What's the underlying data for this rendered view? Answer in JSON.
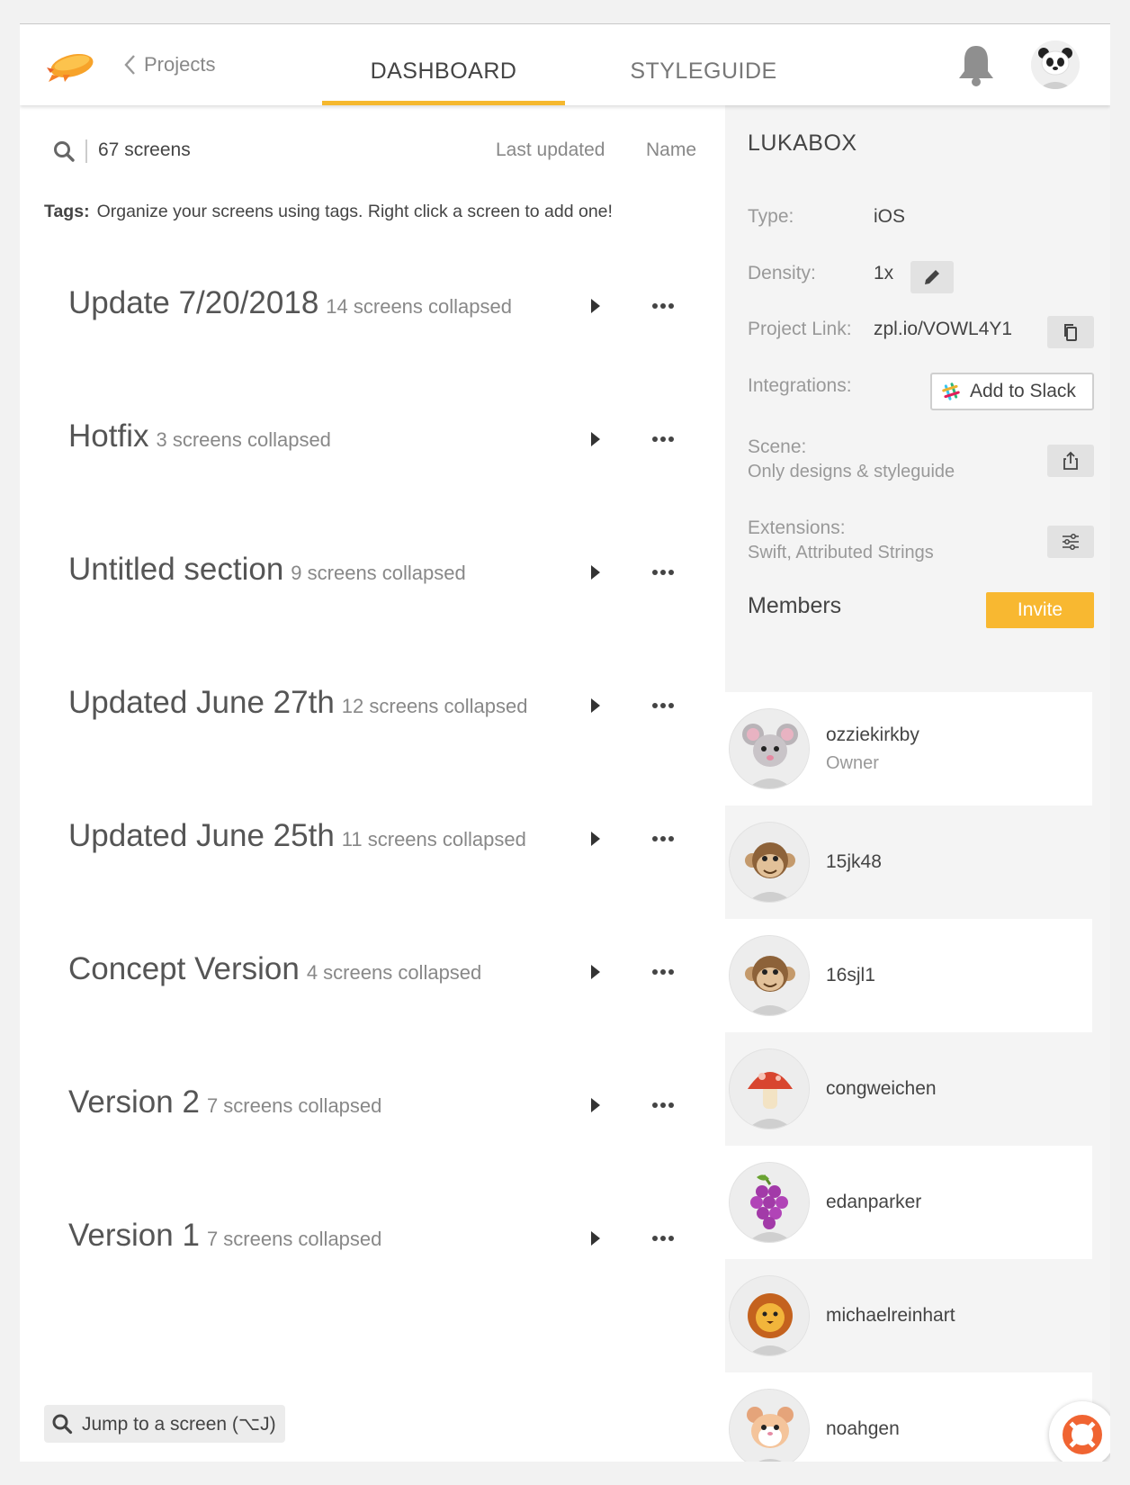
{
  "header": {
    "back_label": "Projects",
    "tabs": [
      {
        "label": "DASHBOARD",
        "active": true
      },
      {
        "label": "STYLEGUIDE",
        "active": false
      }
    ],
    "accent_color": "#f5b82e"
  },
  "dashboard": {
    "screen_count": "67 screens",
    "sort_options": [
      "Last updated",
      "Name"
    ],
    "tags_label": "Tags:",
    "tags_hint": "Organize your screens using tags. Right click a screen to add one!",
    "sections": [
      {
        "title": "Update 7/20/2018",
        "count": "14 screens collapsed"
      },
      {
        "title": "Hotfix",
        "count": "3 screens collapsed"
      },
      {
        "title": "Untitled section",
        "count": "9 screens collapsed"
      },
      {
        "title": "Updated June 27th",
        "count": "12 screens collapsed"
      },
      {
        "title": "Updated June 25th",
        "count": "11 screens collapsed"
      },
      {
        "title": "Concept Version",
        "count": "4 screens collapsed"
      },
      {
        "title": "Version 2",
        "count": "7 screens collapsed"
      },
      {
        "title": "Version 1",
        "count": "7 screens collapsed"
      }
    ],
    "jump_label": "Jump to a screen (⌥J)"
  },
  "project": {
    "name": "LUKABOX",
    "type_label": "Type:",
    "type_value": "iOS",
    "density_label": "Density:",
    "density_value": "1x",
    "link_label": "Project Link:",
    "link_value": "zpl.io/VOWL4Y1",
    "integrations_label": "Integrations:",
    "slack_label": "Add to Slack",
    "scene_label": "Scene:",
    "scene_value": "Only designs & styleguide",
    "extensions_label": "Extensions:",
    "extensions_value": "Swift, Attributed Strings",
    "members_title": "Members",
    "invite_label": "Invite",
    "invite_color": "#f8b831"
  },
  "members": [
    {
      "username": "ozziekirkby",
      "role": "Owner",
      "avatar": "mouse-icon"
    },
    {
      "username": "15jk48",
      "role": "",
      "avatar": "monkey-icon"
    },
    {
      "username": "16sjl1",
      "role": "",
      "avatar": "monkey-icon"
    },
    {
      "username": "congweichen",
      "role": "",
      "avatar": "mushroom-icon"
    },
    {
      "username": "edanparker",
      "role": "",
      "avatar": "grapes-icon"
    },
    {
      "username": "michaelreinhart",
      "role": "",
      "avatar": "lion-icon"
    },
    {
      "username": "noahgen",
      "role": "",
      "avatar": "hamster-icon"
    }
  ]
}
